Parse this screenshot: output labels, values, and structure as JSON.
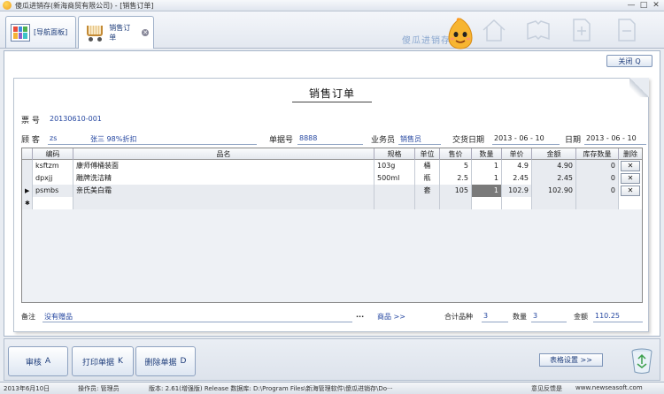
{
  "window": {
    "title": "傻瓜进销存(新海商贸有限公司) - [销售订单]",
    "min": "—",
    "max": "□",
    "close": "✕"
  },
  "tabs": [
    {
      "label": "[导航面板]"
    },
    {
      "label": "销售订单"
    }
  ],
  "brand": "傻瓜进销存",
  "toolbar": {
    "close_label": "关闭",
    "close_key": "Q"
  },
  "doc": {
    "title": "销售订单",
    "ticket_label": "票  号",
    "ticket_value": "20130610-001",
    "customer_label": "顾  客",
    "customer_code": "zs",
    "customer_name": "张三 98%折扣",
    "bill_no_label": "单据号",
    "bill_no_value": "8888",
    "salesman_label": "业务员",
    "salesman_value": "销售员",
    "delivery_label": "交货日期",
    "delivery_value": "2013 - 06 - 10",
    "date_label": "日期",
    "date_value": "2013 - 06 - 10"
  },
  "grid": {
    "headers": [
      "编码",
      "品名",
      "规格",
      "单位",
      "售价",
      "数量",
      "单价",
      "金额",
      "库存数量",
      "删除"
    ],
    "rows": [
      {
        "marker": "",
        "code": "ksftzm",
        "name": "康师傅桶装面",
        "spec": "103g",
        "unit": "桶",
        "price": "5",
        "qty": "1",
        "unit_price": "4.9",
        "amount": "4.90",
        "stock": "0",
        "del": "✕"
      },
      {
        "marker": "",
        "code": "dpxjj",
        "name": "雕牌洗洁精",
        "spec": "500ml",
        "unit": "瓶",
        "price": "2.5",
        "qty": "1",
        "unit_price": "2.45",
        "amount": "2.45",
        "stock": "0",
        "del": "✕"
      },
      {
        "marker": "▶",
        "code": "psmbs",
        "name": "亲氏美白霜",
        "spec": "",
        "unit": "套",
        "price": "105",
        "qty": "1",
        "unit_price": "102.9",
        "amount": "102.90",
        "stock": "0",
        "del": "✕"
      }
    ],
    "new_row_marker": "✱"
  },
  "footer": {
    "remark_label": "备注",
    "remark_value": "没有赠品",
    "more": "...",
    "goods_link": "商品 >>",
    "kinds_label": "合计品种",
    "kinds_value": "3",
    "qty_label": "数量",
    "qty_value": "3",
    "amount_label": "金额",
    "amount_value": "110.25"
  },
  "buttons": {
    "audit": "审核",
    "audit_key": "A",
    "print": "打印单据",
    "print_key": "K",
    "delete": "删除单据",
    "delete_key": "D",
    "settings": "表格设置 >>"
  },
  "status": {
    "date": "2013年6月10日",
    "operator": "操作员: 管理员",
    "version": "版本: 2.61(增强版) Release  数据库: D:\\Program Files\\新海管理软件\\傻瓜进销存\\Do···",
    "feedback": "意见反馈是",
    "website": "www.newseasoft.com"
  }
}
